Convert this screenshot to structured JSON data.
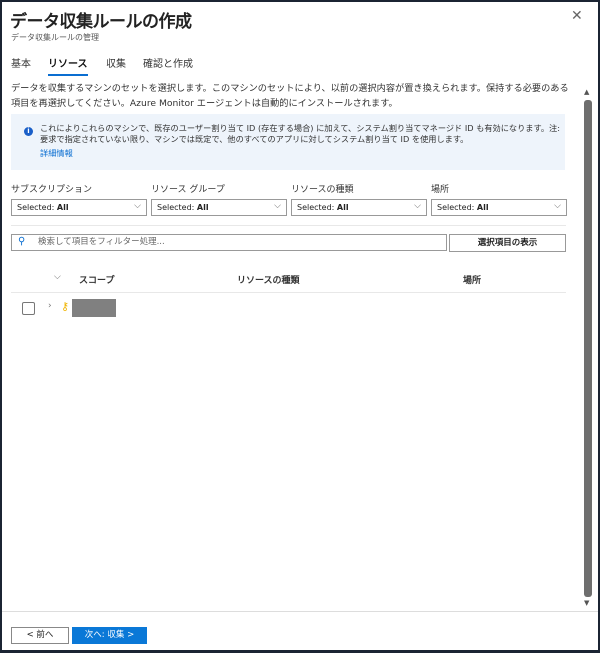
{
  "header": {
    "title": "データ収集ルールの作成",
    "subtitle": "データ収集ルールの管理",
    "close": "✕"
  },
  "tabs": [
    {
      "label": "基本"
    },
    {
      "label": "リソース",
      "active": true
    },
    {
      "label": "収集"
    },
    {
      "label": "確認と作成"
    }
  ],
  "description": "データを収集するマシンのセットを選択します。このマシンのセットにより、以前の選択内容が置き換えられます。保持する必要のある項目を再選択してください。Azure Monitor エージェントは自動的にインストールされます。",
  "info": {
    "text": "これによりこれらのマシンで、既存のユーザー割り当て ID (存在する場合) に加えて、システム割り当てマネージド ID も有効になります。注: 要求で指定されていない限り、マシンでは既定で、他のすべてのアプリに対してシステム割り当て ID を使用します。",
    "link": "詳細情報"
  },
  "filters": [
    {
      "label": "サブスクリプション",
      "prefix": "Selected: ",
      "value": "All"
    },
    {
      "label": "リソース グループ",
      "prefix": "Selected: ",
      "value": "All"
    },
    {
      "label": "リソースの種類",
      "prefix": "Selected: ",
      "value": "All"
    },
    {
      "label": "場所",
      "prefix": "Selected: ",
      "value": "All"
    }
  ],
  "search": {
    "placeholder": "検索して項目をフィルター処理...",
    "show_selected": "選択項目の表示"
  },
  "table": {
    "columns": [
      "スコープ",
      "リソースの種類",
      "場所"
    ]
  },
  "footer": {
    "prev": "< 前へ",
    "next": "次へ: 収集 >"
  },
  "colors": {
    "accent": "#0a78d7",
    "info_bg": "#eef4fb",
    "key": "#f0b400"
  }
}
